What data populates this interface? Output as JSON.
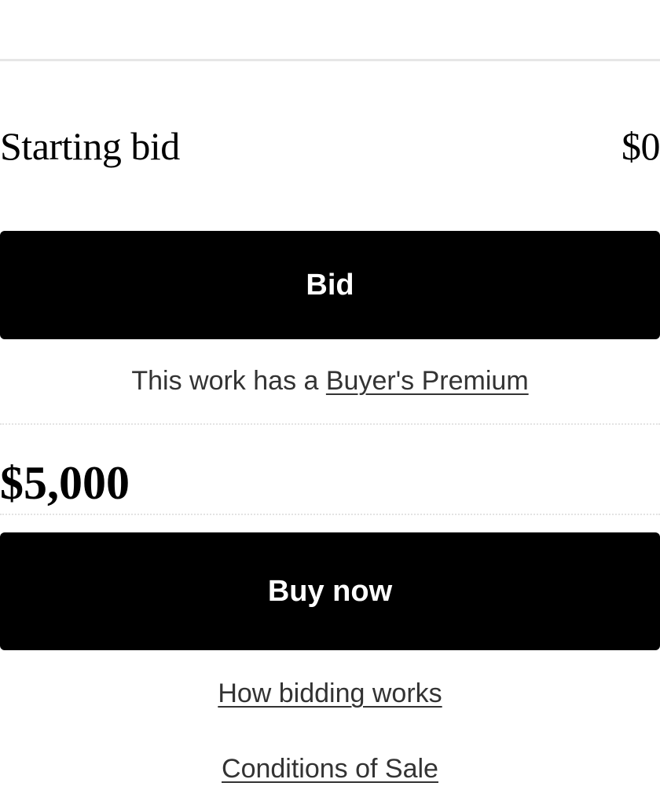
{
  "starting_bid": {
    "label": "Starting bid",
    "value": "$0"
  },
  "bid_button": {
    "label": "Bid"
  },
  "premium_notice": {
    "prefix": "This work has a ",
    "link_text": "Buyer's Premium"
  },
  "buy_now": {
    "price": "$5,000",
    "button_label": "Buy now"
  },
  "footer_links": {
    "how_bidding_works": "How bidding works",
    "conditions_of_sale": "Conditions of Sale"
  },
  "colors": {
    "button_background": "#000000",
    "button_text": "#ffffff",
    "link_text": "#333333",
    "divider": "#e6e6e6"
  }
}
